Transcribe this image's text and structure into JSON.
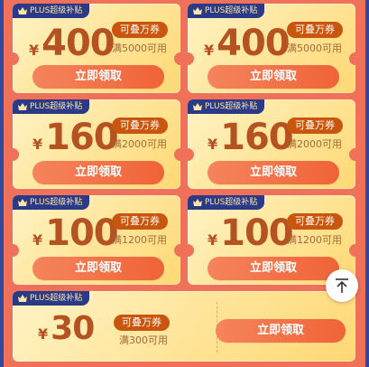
{
  "colors": {
    "page_bg": "#f0715a",
    "coupon_bg": "#ffe497",
    "plus_tag_bg": "#2a3a86",
    "price_text": "#b45321",
    "badge_bg": "#c8560f",
    "button_bg": "#f06338"
  },
  "coupons": [
    {
      "tag": "PLUS超级补贴",
      "currency": "¥",
      "amount": "400",
      "badge": "可叠万券",
      "condition": "满5000可用",
      "button": "立即领取"
    },
    {
      "tag": "PLUS超级补贴",
      "currency": "¥",
      "amount": "400",
      "badge": "可叠万券",
      "condition": "满5000可用",
      "button": "立即领取"
    },
    {
      "tag": "PLUS超级补贴",
      "currency": "¥",
      "amount": "160",
      "badge": "可叠万券",
      "condition": "满2000可用",
      "button": "立即领取"
    },
    {
      "tag": "PLUS超级补贴",
      "currency": "¥",
      "amount": "160",
      "badge": "可叠万券",
      "condition": "满2000可用",
      "button": "立即领取"
    },
    {
      "tag": "PLUS超级补贴",
      "currency": "¥",
      "amount": "100",
      "badge": "可叠万券",
      "condition": "满1200可用",
      "button": "立即领取"
    },
    {
      "tag": "PLUS超级补贴",
      "currency": "¥",
      "amount": "100",
      "badge": "可叠万券",
      "condition": "满1200可用",
      "button": "立即领取"
    },
    {
      "tag": "PLUS超级补贴",
      "currency": "¥",
      "amount": "30",
      "badge": "可叠万券",
      "condition": "满300可用",
      "button": "立即领取"
    }
  ],
  "icons": {
    "plus_tag": "crown-icon",
    "scroll_top": "arrow-up-to-top-icon"
  }
}
